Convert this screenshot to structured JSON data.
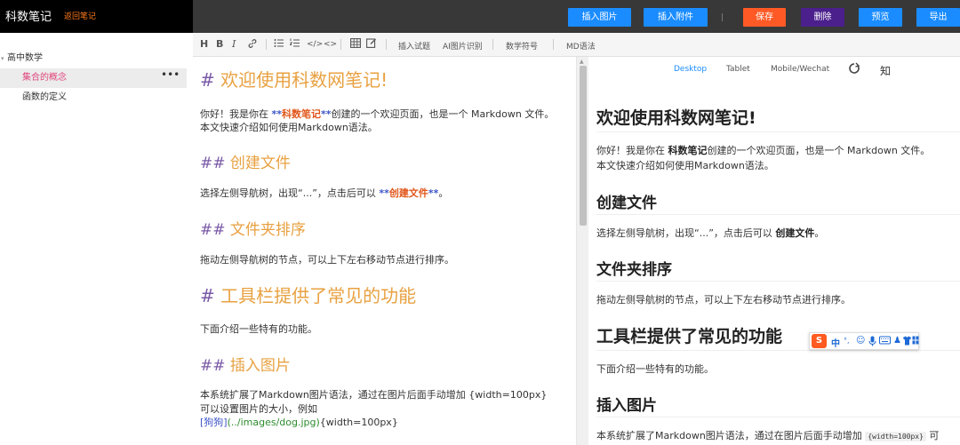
{
  "header": {
    "app_title": "科数笔记",
    "back_link": "返回笔记",
    "buttons": {
      "insert_image": "插入图片",
      "insert_attachment": "插入附件",
      "save": "保存",
      "delete": "删除",
      "preview": "预览",
      "export": "导出"
    },
    "colors": {
      "blue": "#1a8cff",
      "orange": "#ff5a26",
      "purple": "#4b1f8c",
      "brand_bg": "#000000",
      "bar_bg": "#383838"
    }
  },
  "sidebar": {
    "root": "高中数学",
    "items": [
      {
        "label": "集合的概念",
        "active": true,
        "more": "•••"
      },
      {
        "label": "函数的定义",
        "active": false
      }
    ]
  },
  "toolbar": {
    "icons": [
      "heading-icon",
      "bold-icon",
      "italic-icon",
      "link-icon",
      "unordered-list-icon",
      "ordered-list-icon",
      "code-icon",
      "inline-code-icon",
      "table-icon",
      "edit-icon"
    ],
    "text_items": {
      "insert_exercise": "插入试题",
      "ai_image": "AI图片识别",
      "math_symbols": "数学符号",
      "md_syntax": "MD语法"
    }
  },
  "editor": {
    "h1_mark": "#",
    "h2_mark": "##",
    "title": "欢迎使用科数网笔记!",
    "intro_pre": "你好！我是你在 ",
    "bold_marker": "**",
    "intro_brand": "科数笔记",
    "intro_post": "创建的一个欢迎页面，也是一个 Markdown 文件。",
    "intro_line2": "本文快速介绍如何使用Markdown语法。",
    "h_create": "创建文件",
    "create_pre": "选择左侧导航树，出现“...”，点击后可以 ",
    "create_bold": "创建文件",
    "create_post": "。",
    "h_sort": "文件夹排序",
    "sort_text": "拖动左侧导航树的节点，可以上下左右移动节点进行排序。",
    "h_toolbar": "工具栏提供了常见的功能",
    "toolbar_text": "下面介绍一些特有的功能。",
    "h_image": "插入图片",
    "image_line1": "本系统扩展了Markdown图片语法，通过在图片后面手动增加 {width=100px}",
    "image_line2": "可以设置图片的大小，例如",
    "image_bracket_open": "[",
    "image_alt": "狗狗",
    "image_bracket_close": "]",
    "image_url": "(../images/dog.jpg)",
    "image_suffix": "{width=100px}"
  },
  "preview": {
    "tabs": {
      "desktop": "Desktop",
      "tablet": "Tablet",
      "mobile": "Mobile/Wechat",
      "zhihu": "知"
    },
    "title": "欢迎使用科数网笔记!",
    "intro_pre": "你好！我是你在 ",
    "intro_brand": "科数笔记",
    "intro_post": "创建的一个欢迎页面，也是一个 Markdown 文件。",
    "intro_line2": "本文快速介绍如何使用Markdown语法。",
    "h_create": "创建文件",
    "create_pre": "选择左侧导航树，出现“...”，点击后可以 ",
    "create_bold": "创建文件",
    "create_post": "。",
    "h_sort": "文件夹排序",
    "sort_text": "拖动左侧导航树的节点，可以上下左右移动节点进行排序。",
    "h_toolbar": "工具栏提供了常见的功能",
    "toolbar_text": "下面介绍一些特有的功能。",
    "h_image": "插入图片",
    "image_line1": "本系统扩展了Markdown图片语法，通过在图片后面手动增加 ",
    "image_code": "{width=100px}",
    "image_tail": " 可"
  },
  "ime": {
    "mode": "中",
    "punct": "°,"
  }
}
